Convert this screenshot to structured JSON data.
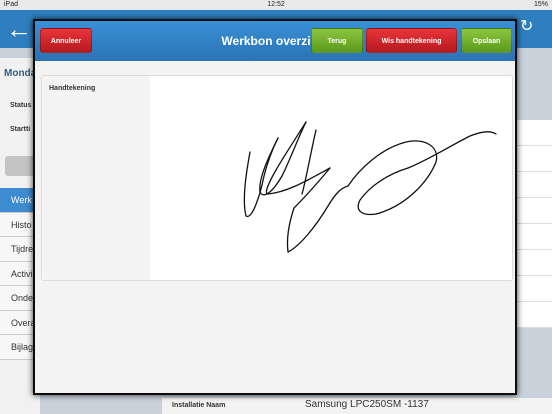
{
  "status_bar": {
    "device": "iPad",
    "time": "12:52",
    "battery": "15%"
  },
  "background_app": {
    "title": "Monda",
    "status_label": "Status",
    "start_label": "Startti",
    "menu_items": [
      "Werk",
      "Histo",
      "Tijdre",
      "Activi",
      "Onde",
      "Overa",
      "Bijlag"
    ],
    "installation_label": "Installatie Naam",
    "installation_value": "Samsung LPC250SM -1137"
  },
  "modal": {
    "title": "Werkbon overzicht",
    "cancel_label": "Annuleer",
    "back_label": "Terug",
    "clear_signature_label": "Wis handtekening",
    "save_label": "Opslaan",
    "signature_label": "Handtekening"
  },
  "colors": {
    "header_blue": "#2f7fc0",
    "button_red": "#c8262a",
    "button_green": "#6fae2c"
  }
}
